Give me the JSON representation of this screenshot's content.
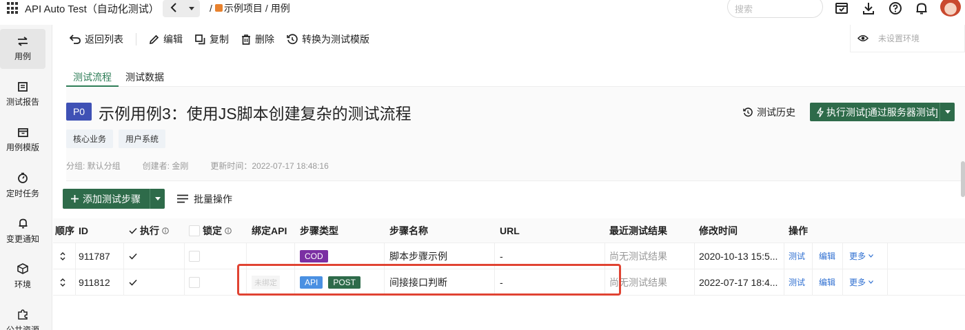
{
  "topbar": {
    "app_title": "API Auto Test（自动化测试）",
    "breadcrumb": [
      "/",
      "示例项目",
      "/",
      "用例"
    ],
    "search_placeholder": "搜索"
  },
  "sidebar": {
    "items": [
      {
        "label": "用例",
        "icon": "swap-icon",
        "active": true
      },
      {
        "label": "测试报告",
        "icon": "report-icon"
      },
      {
        "label": "用例模版",
        "icon": "template-icon"
      },
      {
        "label": "定时任务",
        "icon": "timer-icon"
      },
      {
        "label": "变更通知",
        "icon": "bell-icon"
      },
      {
        "label": "环境",
        "icon": "cube-icon"
      },
      {
        "label": "公共资源",
        "icon": "puzzle-icon"
      }
    ]
  },
  "toolbar": {
    "back_label": "返回列表",
    "edit_label": "编辑",
    "copy_label": "复制",
    "delete_label": "删除",
    "convert_label": "转换为测试模版",
    "env_placeholder": "未设置环境"
  },
  "tabs": [
    {
      "label": "测试流程",
      "active": true
    },
    {
      "label": "测试数据",
      "active": false
    }
  ],
  "case": {
    "priority": "P0",
    "title": "示例用例3：使用JS脚本创建复杂的测试流程",
    "history_label": "测试历史",
    "run_label": "执行测试[通过服务器测试]",
    "tags": [
      "核心业务",
      "用户系统"
    ],
    "group": "分组: 默认分组",
    "creator": "创建者: 金刚",
    "updated": "更新时间：2022-07-17 18:48:16"
  },
  "actions": {
    "add_step_label": "添加测试步骤",
    "batch_label": "批量操作"
  },
  "table": {
    "headers": {
      "order": "顺序",
      "id": "ID",
      "run": "执行",
      "lock": "锁定",
      "bind_api": "绑定API",
      "step_type": "步骤类型",
      "step_name": "步骤名称",
      "url": "URL",
      "last_result": "最近测试结果",
      "modified": "修改时间",
      "ops": "操作"
    },
    "rows": [
      {
        "id": "911787",
        "bind": "",
        "type": "COD",
        "method": "",
        "name": "脚本步骤示例",
        "url": "-",
        "result": "尚无测试结果",
        "modified": "2020-10-13 15:5...",
        "test": "测试",
        "edit": "编辑",
        "more": "更多"
      },
      {
        "id": "911812",
        "bind": "未绑定",
        "type": "API",
        "method": "POST",
        "name": "间接接口判断",
        "url": "-",
        "result": "尚无测试结果",
        "modified": "2022-07-17 18:4...",
        "test": "测试",
        "edit": "编辑",
        "more": "更多"
      }
    ]
  },
  "colors": {
    "primary_green": "#2e6b4a",
    "priority_blue": "#3f51b5",
    "cod_purple": "#7b2fa3",
    "api_blue": "#4a90e2",
    "highlight_red": "#e04332"
  }
}
